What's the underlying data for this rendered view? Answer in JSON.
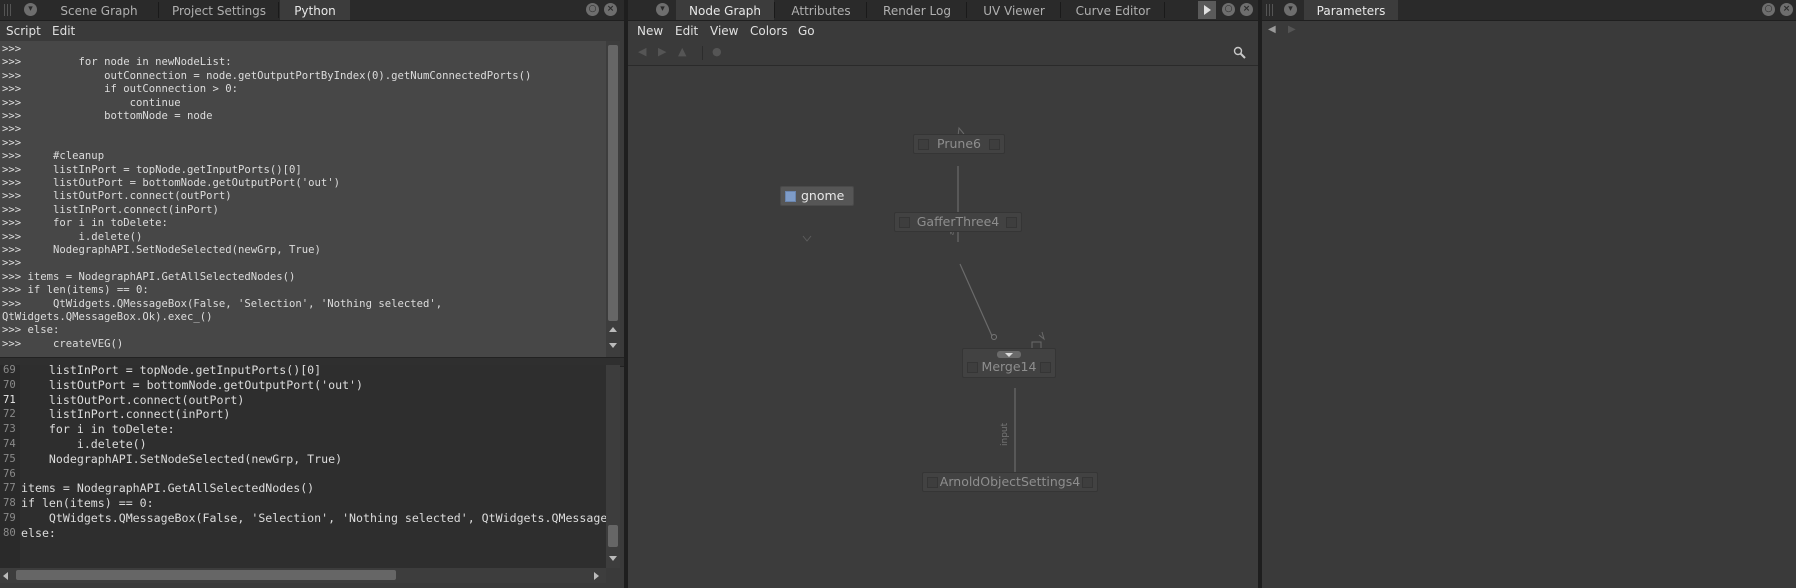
{
  "left_pane": {
    "tabs": [
      "Scene Graph",
      "Project Settings",
      "Python"
    ],
    "menu": [
      "Script",
      "Edit"
    ],
    "output_lines": [
      {
        "prompt": ">>>",
        "code": ""
      },
      {
        "prompt": ">>>",
        "code": "        for node in newNodeList:"
      },
      {
        "prompt": ">>>",
        "code": "            outConnection = node.getOutputPortByIndex(0).getNumConnectedPorts()"
      },
      {
        "prompt": ">>>",
        "code": "            if outConnection > 0:"
      },
      {
        "prompt": ">>>",
        "code": "                continue"
      },
      {
        "prompt": ">>>",
        "code": "            bottomNode = node"
      },
      {
        "prompt": ">>>",
        "code": ""
      },
      {
        "prompt": ">>>",
        "code": ""
      },
      {
        "prompt": ">>>",
        "code": "    #cleanup"
      },
      {
        "prompt": ">>>",
        "code": "    listInPort = topNode.getInputPorts()[0]"
      },
      {
        "prompt": ">>>",
        "code": "    listOutPort = bottomNode.getOutputPort('out')"
      },
      {
        "prompt": ">>>",
        "code": "    listOutPort.connect(outPort)"
      },
      {
        "prompt": ">>>",
        "code": "    listInPort.connect(inPort)"
      },
      {
        "prompt": ">>>",
        "code": "    for i in toDelete:"
      },
      {
        "prompt": ">>>",
        "code": "        i.delete()"
      },
      {
        "prompt": ">>>",
        "code": "    NodegraphAPI.SetNodeSelected(newGrp, True)"
      },
      {
        "prompt": ">>>",
        "code": ""
      },
      {
        "prompt": ">>>",
        "code": "items = NodegraphAPI.GetAllSelectedNodes()"
      },
      {
        "prompt": ">>>",
        "code": "if len(items) == 0:"
      },
      {
        "prompt": ">>>",
        "code": "    QtWidgets.QMessageBox(False, 'Selection', 'Nothing selected',"
      },
      {
        "prompt": "",
        "code": "QtWidgets.QMessageBox.Ok).exec_()"
      },
      {
        "prompt": ">>>",
        "code": "else:"
      },
      {
        "prompt": ">>>",
        "code": "    createVEG()"
      }
    ],
    "editor_lines": [
      {
        "num": "69",
        "code": "    listInPort = topNode.getInputPorts()[0]"
      },
      {
        "num": "70",
        "code": "    listOutPort = bottomNode.getOutputPort('out')"
      },
      {
        "num": "71",
        "code": "    listOutPort.connect(outPort)"
      },
      {
        "num": "72",
        "code": "    listInPort.connect(inPort)"
      },
      {
        "num": "73",
        "code": "    for i in toDelete:"
      },
      {
        "num": "74",
        "code": "        i.delete()"
      },
      {
        "num": "75",
        "code": "    NodegraphAPI.SetNodeSelected(newGrp, True)"
      },
      {
        "num": "76",
        "code": ""
      },
      {
        "num": "77",
        "code": "items = NodegraphAPI.GetAllSelectedNodes()"
      },
      {
        "num": "78",
        "code": "if len(items) == 0:"
      },
      {
        "num": "79",
        "code": "    QtWidgets.QMessageBox(False, 'Selection', 'Nothing selected', QtWidgets.QMessageBox.("
      },
      {
        "num": "80",
        "code": "else:"
      }
    ]
  },
  "mid_pane": {
    "tabs": [
      "Node Graph",
      "Attributes",
      "Render Log",
      "UV Viewer",
      "Curve Editor"
    ],
    "menu": [
      "New",
      "Edit",
      "View",
      "Colors",
      "Go"
    ],
    "nodes": {
      "gnome": "gnome",
      "prune": "Prune6",
      "gaffer": "GafferThree4",
      "merge": "Merge14",
      "arnold": "ArnoldObjectSettings4"
    },
    "port_label": "input"
  },
  "right_pane": {
    "tabs": [
      "Parameters"
    ]
  },
  "colors": {
    "accent_node": "#7e9cc8",
    "active_tab": "#3c3c3c"
  }
}
